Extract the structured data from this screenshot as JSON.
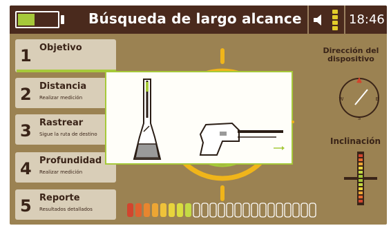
{
  "header": {
    "title": "Búsqueda de largo alcance",
    "time": "18:46",
    "battery_level": 0.4,
    "signal_bars_active": 4,
    "colors": {
      "bar": "#4a2a1d",
      "accent": "#a6c93a",
      "signal": "#e2cd2a"
    }
  },
  "menu": [
    {
      "num": "1",
      "title": "Objetivo",
      "sub": "",
      "active": true
    },
    {
      "num": "2",
      "title": "Distancia",
      "sub": "Realizar medición",
      "active": false
    },
    {
      "num": "3",
      "title": "Rastrear",
      "sub": "Sigue la ruta de destino",
      "active": false
    },
    {
      "num": "4",
      "title": "Profundidad",
      "sub": "Realizar medición",
      "active": false
    },
    {
      "num": "5",
      "title": "Reporte",
      "sub": "Resultados detallados",
      "active": false
    }
  ],
  "compass": {
    "label": "Dirección del dispositivo",
    "n": "N",
    "e": "E",
    "s": "S",
    "w": "W"
  },
  "tilt": {
    "label": "Inclinación"
  },
  "meter": {
    "total_segments": 23,
    "active_segments": 8,
    "colors": [
      "#d2452e",
      "#e0612f",
      "#e8862f",
      "#eda634",
      "#efc23a",
      "#e8d43c",
      "#d9dd3f",
      "#c4da44"
    ]
  },
  "overlay": {
    "icons": [
      "detector-front-icon",
      "detector-side-icon"
    ]
  }
}
